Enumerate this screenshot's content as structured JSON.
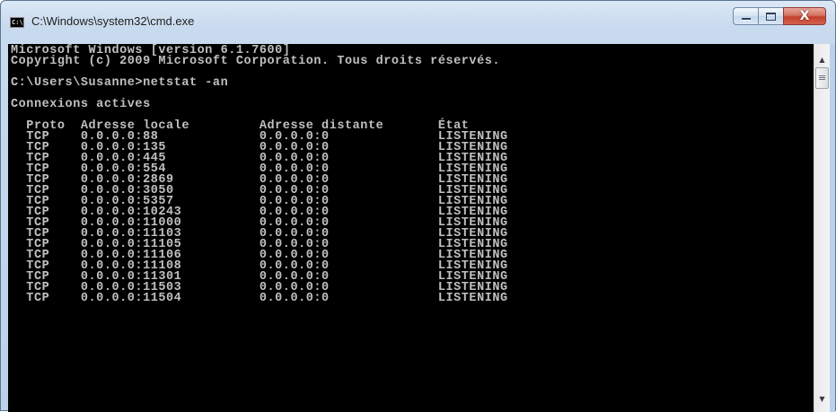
{
  "window": {
    "title": "C:\\Windows\\system32\\cmd.exe",
    "icon": "console-icon",
    "icon_text": "C:\\",
    "buttons": {
      "minimize_icon": "minimize-icon",
      "maximize_icon": "maximize-icon",
      "close_icon": "close-icon",
      "close_glyph": "X"
    }
  },
  "console": {
    "lines": [
      "Microsoft Windows [version 6.1.7600]",
      "Copyright (c) 2009 Microsoft Corporation. Tous droits réservés.",
      "",
      "C:\\Users\\Susanne>netstat -an",
      "",
      "Connexions actives",
      "",
      "  Proto  Adresse locale         Adresse distante       État",
      "  TCP    0.0.0.0:88             0.0.0.0:0              LISTENING",
      "  TCP    0.0.0.0:135            0.0.0.0:0              LISTENING",
      "  TCP    0.0.0.0:445            0.0.0.0:0              LISTENING",
      "  TCP    0.0.0.0:554            0.0.0.0:0              LISTENING",
      "  TCP    0.0.0.0:2869           0.0.0.0:0              LISTENING",
      "  TCP    0.0.0.0:3050           0.0.0.0:0              LISTENING",
      "  TCP    0.0.0.0:5357           0.0.0.0:0              LISTENING",
      "  TCP    0.0.0.0:10243          0.0.0.0:0              LISTENING",
      "  TCP    0.0.0.0:11000          0.0.0.0:0              LISTENING",
      "  TCP    0.0.0.0:11103          0.0.0.0:0              LISTENING",
      "  TCP    0.0.0.0:11105          0.0.0.0:0              LISTENING",
      "  TCP    0.0.0.0:11106          0.0.0.0:0              LISTENING",
      "  TCP    0.0.0.0:11108          0.0.0.0:0              LISTENING",
      "  TCP    0.0.0.0:11301          0.0.0.0:0              LISTENING",
      "  TCP    0.0.0.0:11503          0.0.0.0:0              LISTENING",
      "  TCP    0.0.0.0:11504          0.0.0.0:0              LISTENING"
    ],
    "background": "#000000",
    "foreground": "#c0c0c0"
  },
  "scrollbar": {
    "up_icon": "scroll-up-arrow-icon",
    "down_icon": "scroll-down-arrow-icon",
    "up_glyph": "▲",
    "down_glyph": "▼"
  }
}
